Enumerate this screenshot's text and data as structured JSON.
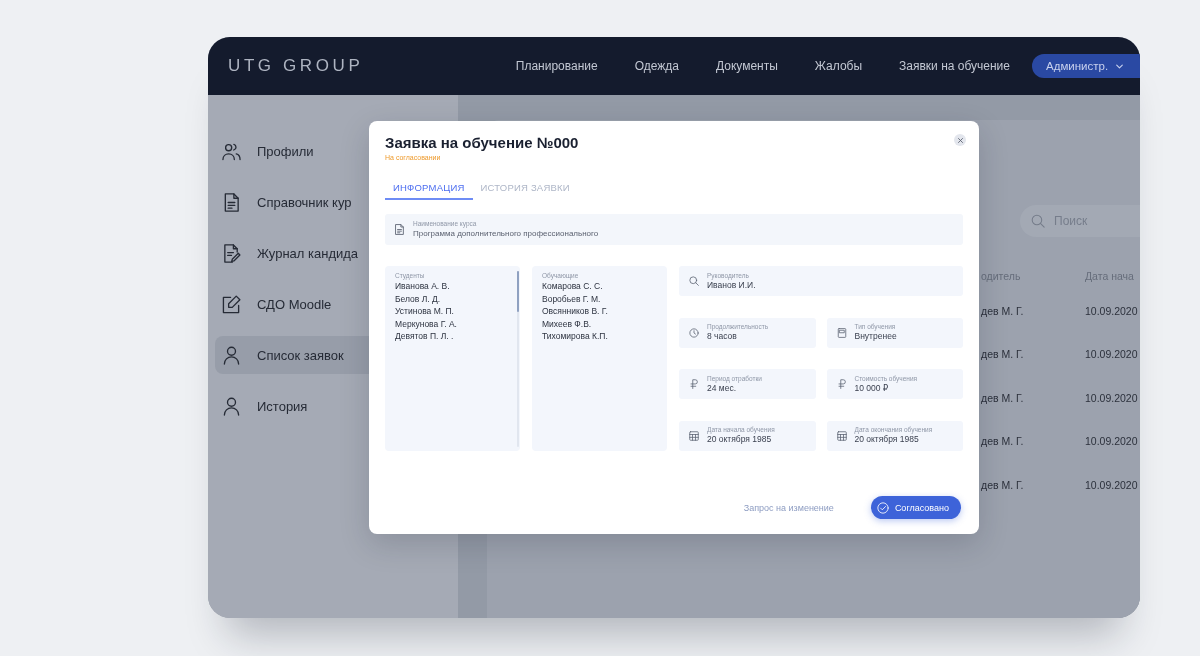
{
  "navbar": {
    "logo": "UTG GROUP",
    "links": [
      "Планирование",
      "Одежда",
      "Документы",
      "Жалобы",
      "Заявки на обучение"
    ],
    "account": "Администр."
  },
  "sidebar": {
    "items": [
      {
        "kind": "users",
        "label": "Профили",
        "selected": false
      },
      {
        "kind": "document",
        "label": "Справочник кур",
        "selected": false
      },
      {
        "kind": "document-pen",
        "label": "Журнал кандида",
        "selected": false
      },
      {
        "kind": "edit",
        "label": "СДО Moodle",
        "selected": false
      },
      {
        "kind": "person",
        "label": "Список заявок",
        "selected": true
      },
      {
        "kind": "person",
        "label": "История",
        "selected": false
      }
    ]
  },
  "content": {
    "search": {
      "placeholder": "Поиск"
    },
    "table": {
      "columns": [
        "одитель",
        "Дата нача"
      ],
      "rows": [
        [
          "дев М. Г.",
          "10.09.2020"
        ],
        [
          "дев М. Г.",
          "10.09.2020"
        ],
        [
          "дев М. Г.",
          "10.09.2020"
        ],
        [
          "дев М. Г.",
          "10.09.2020"
        ],
        [
          "дев М. Г.",
          "10.09.2020"
        ]
      ]
    }
  },
  "dialog": {
    "title": "Заявка на обучение №000",
    "status": "На согласовании",
    "tabs": [
      {
        "label": "ИНФОРМАЦИЯ",
        "selected": true
      },
      {
        "label": "ИСТОРИЯ ЗАЯВКИ",
        "selected": false
      }
    ],
    "course": {
      "label": "Наименование курса",
      "value": "Программа дополнительного профессионального"
    },
    "students": {
      "label": "Студенты",
      "items": [
        "Иванова А. В.",
        "Белов Л. Д.",
        "Устинова М. П.",
        "Меркунова Г. А.",
        "Девятов П. Л. ."
      ]
    },
    "trainers": {
      "label": "Обучающие",
      "items": [
        "Комарова С. С.",
        "Воробьев Г. М.",
        "Овсянников В. Г.",
        "Михеев Ф.В.",
        "Тихомирова К.П."
      ]
    },
    "manager": {
      "kind": "search",
      "label": "Руководитель",
      "value": "Иванов И.И."
    },
    "details": [
      {
        "kind": "clock",
        "label": "Продолжительность",
        "value": "8 часов"
      },
      {
        "kind": "book",
        "label": "Тип обучения",
        "value": "Внутренее"
      },
      {
        "kind": "ruble",
        "label": "Период отработки",
        "value": "24 мес."
      },
      {
        "kind": "ruble",
        "label": "Стоимость обучения",
        "value": "10 000 ₽"
      },
      {
        "kind": "calendar",
        "label": "Дата начала обучения",
        "value": "20 октября 1985"
      },
      {
        "kind": "calendar",
        "label": "Дата окончания обучения",
        "value": "20 октября 1985"
      }
    ],
    "actions": {
      "link": "Запрос на изменение",
      "button": "Согласовано"
    }
  }
}
